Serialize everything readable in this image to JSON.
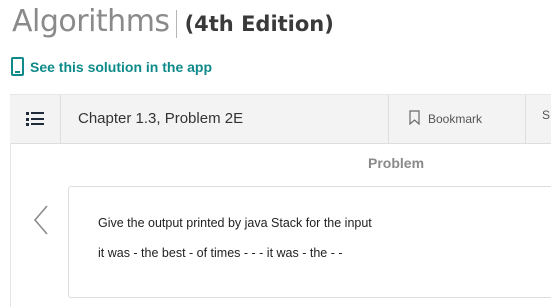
{
  "book": {
    "title": "Algorithms",
    "edition": "(4th Edition)"
  },
  "app_link": {
    "icon": "phone-icon",
    "label": "See this solution in the app"
  },
  "toolbar": {
    "menu_icon": "list-icon",
    "chapter": "Chapter 1.3, Problem 2E",
    "bookmark_icon": "bookmark-icon",
    "bookmark_label": "Bookmark",
    "share_label": "S"
  },
  "problem": {
    "heading": "Problem",
    "prev_icon": "chevron-left-icon",
    "line1": "Give the output printed by java Stack for the input",
    "line2": "it was - the best - of times - - - it was - the - -"
  },
  "colors": {
    "accent": "#0f8a8a",
    "toolbar_bg": "#f3f3f3",
    "title_gray": "#8a8a8a"
  }
}
